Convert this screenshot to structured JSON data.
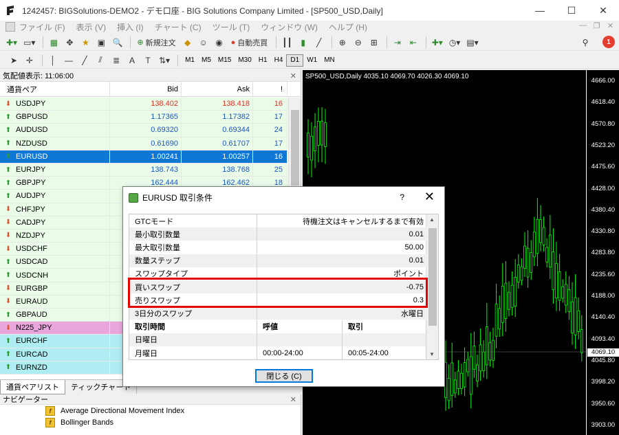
{
  "window": {
    "title": "1242457: BIGSolutions-DEMO2 - デモ口座 - BIG Solutions Company Limited - [SP500_USD,Daily]",
    "controls": [
      "—",
      "☐",
      "✕"
    ]
  },
  "menu": {
    "items": [
      "ファイル (F)",
      "表示 (V)",
      "挿入 (I)",
      "チャート (C)",
      "ツール (T)",
      "ウィンドウ (W)",
      "ヘルプ (H)"
    ],
    "mdi_controls": [
      "—",
      "❐",
      "✕"
    ]
  },
  "toolbar1": {
    "new_order_label": "新規注文",
    "auto_trade_label": "自動売買",
    "notification_count": "1"
  },
  "toolbar2": {
    "timeframes": [
      "M1",
      "M5",
      "M15",
      "M30",
      "H1",
      "H4",
      "D1",
      "W1",
      "MN"
    ],
    "active_timeframe": "D1"
  },
  "market_watch": {
    "header": "気配値表示: 11:06:00",
    "columns": {
      "symbol": "通貨ペア",
      "bid": "Bid",
      "ask": "Ask",
      "spread": "!"
    },
    "rows": [
      {
        "symbol": "USDJPY",
        "bid": "138.402",
        "ask": "138.418",
        "spread": "16",
        "bg": "green",
        "color": "red",
        "arrow": "down"
      },
      {
        "symbol": "GBPUSD",
        "bid": "1.17365",
        "ask": "1.17382",
        "spread": "17",
        "bg": "green",
        "color": "blue",
        "arrow": "up"
      },
      {
        "symbol": "AUDUSD",
        "bid": "0.69320",
        "ask": "0.69344",
        "spread": "24",
        "bg": "green",
        "color": "blue",
        "arrow": "up"
      },
      {
        "symbol": "NZDUSD",
        "bid": "0.61690",
        "ask": "0.61707",
        "spread": "17",
        "bg": "green",
        "color": "blue",
        "arrow": "up"
      },
      {
        "symbol": "EURUSD",
        "bid": "1.00241",
        "ask": "1.00257",
        "spread": "16",
        "bg": "selected",
        "color": "blue",
        "arrow": "up"
      },
      {
        "symbol": "EURJPY",
        "bid": "138.743",
        "ask": "138.768",
        "spread": "25",
        "bg": "green",
        "color": "blue",
        "arrow": "up"
      },
      {
        "symbol": "GBPJPY",
        "bid": "162.444",
        "ask": "162.462",
        "spread": "18",
        "bg": "green",
        "color": "blue",
        "arrow": "up"
      },
      {
        "symbol": "AUDJPY",
        "bid": "",
        "ask": "",
        "spread": "",
        "bg": "green",
        "color": "blue",
        "arrow": "up"
      },
      {
        "symbol": "CHFJPY",
        "bid": "",
        "ask": "",
        "spread": "",
        "bg": "green",
        "color": "red",
        "arrow": "down"
      },
      {
        "symbol": "CADJPY",
        "bid": "",
        "ask": "",
        "spread": "",
        "bg": "green",
        "color": "red",
        "arrow": "down"
      },
      {
        "symbol": "NZDJPY",
        "bid": "",
        "ask": "",
        "spread": "",
        "bg": "green",
        "color": "red",
        "arrow": "down"
      },
      {
        "symbol": "USDCHF",
        "bid": "",
        "ask": "",
        "spread": "",
        "bg": "green",
        "color": "red",
        "arrow": "down"
      },
      {
        "symbol": "USDCAD",
        "bid": "",
        "ask": "",
        "spread": "",
        "bg": "green",
        "color": "blue",
        "arrow": "up"
      },
      {
        "symbol": "USDCNH",
        "bid": "",
        "ask": "",
        "spread": "",
        "bg": "green",
        "color": "blue",
        "arrow": "up"
      },
      {
        "symbol": "EURGBP",
        "bid": "",
        "ask": "",
        "spread": "",
        "bg": "green",
        "color": "red",
        "arrow": "down"
      },
      {
        "symbol": "EURAUD",
        "bid": "",
        "ask": "",
        "spread": "",
        "bg": "green",
        "color": "red",
        "arrow": "down"
      },
      {
        "symbol": "GBPAUD",
        "bid": "",
        "ask": "",
        "spread": "",
        "bg": "green",
        "color": "blue",
        "arrow": "up"
      },
      {
        "symbol": "N225_JPY",
        "bid": "",
        "ask": "",
        "spread": "",
        "bg": "pink",
        "color": "red",
        "arrow": "down"
      },
      {
        "symbol": "EURCHF",
        "bid": "",
        "ask": "",
        "spread": "",
        "bg": "cyan",
        "color": "blue",
        "arrow": "up"
      },
      {
        "symbol": "EURCAD",
        "bid": "",
        "ask": "",
        "spread": "",
        "bg": "cyan",
        "color": "blue",
        "arrow": "up"
      },
      {
        "symbol": "EURNZD",
        "bid": "",
        "ask": "",
        "spread": "",
        "bg": "cyan",
        "color": "blue",
        "arrow": "up"
      }
    ],
    "tabs": [
      "通貨ペアリスト",
      "ティックチャート"
    ]
  },
  "navigator": {
    "header": "ナビゲーター",
    "items": [
      "Average Directional Movement Index",
      "Bollinger Bands"
    ]
  },
  "chart": {
    "label": "SP500_USD,Daily  4035.10 4069.70 4026.30 4069.10",
    "prices": [
      "4666.00",
      "4618.40",
      "4570.80",
      "4523.20",
      "4475.60",
      "4428.00",
      "4380.40",
      "4330.80",
      "4283.80",
      "4235.60",
      "4188.00",
      "4140.40",
      "4093.40",
      "4045.80",
      "3998.20",
      "3950.60",
      "3903.00"
    ],
    "current_price": "4069.10",
    "candle_color": "#00ff00"
  },
  "dialog": {
    "title": "EURUSD 取引条件",
    "help": "?",
    "close": "✕",
    "rows": [
      {
        "key": "GTCモード",
        "value": "待機注文はキャンセルするまで有効"
      },
      {
        "key": "最小取引数量",
        "value": "0.01"
      },
      {
        "key": "最大取引数量",
        "value": "50.00"
      },
      {
        "key": "数量ステップ",
        "value": "0.01"
      },
      {
        "key": "スワップタイプ",
        "value": "ポイント"
      },
      {
        "key": "買いスワップ",
        "value": "-0.75"
      },
      {
        "key": "売りスワップ",
        "value": "0.3"
      },
      {
        "key": "3日分のスワップ",
        "value": "水曜日"
      }
    ],
    "session_header": {
      "day": "取引時間",
      "quote": "呼値",
      "trade": "取引"
    },
    "sessions": [
      {
        "day": "日曜日",
        "quote": "",
        "trade": ""
      },
      {
        "day": "月曜日",
        "quote": "00:00-24:00",
        "trade": "00:05-24:00"
      }
    ],
    "close_button": "閉じる (C)",
    "highlight_color": "#e50000"
  }
}
